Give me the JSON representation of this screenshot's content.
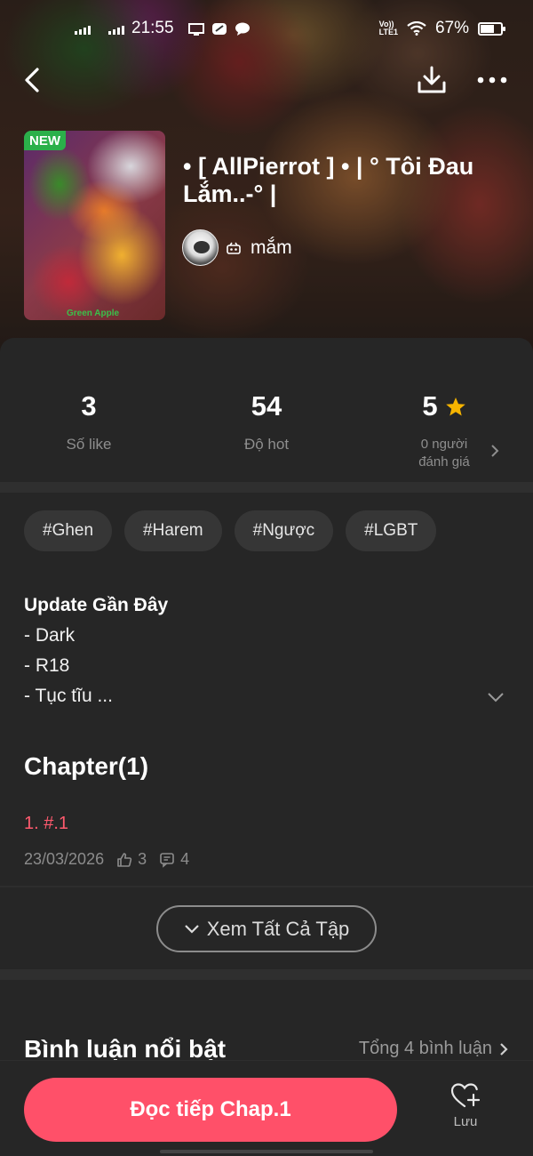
{
  "status_bar": {
    "time": "21:55",
    "network_label": "Vo))\nLTE1",
    "battery_percent": "67%",
    "battery_level": 0.67
  },
  "story": {
    "badge": "NEW",
    "cover_signature": "Green Apple",
    "title": "• [ AllPierrot ] • | ° Tôi Đau Lắm..-° |",
    "author": "mắm"
  },
  "stats": {
    "likes_value": "3",
    "likes_label": "Số like",
    "hot_value": "54",
    "hot_label": "Độ hot",
    "rating_value": "5",
    "rating_sub_line1": "0 người",
    "rating_sub_line2": "đánh giá"
  },
  "tags": [
    "#Ghen",
    "#Harem",
    "#Ngược",
    "#LGBT"
  ],
  "description": {
    "title": "Update Gần Đây",
    "lines": [
      "- Dark",
      "- R18",
      "- Tục tĩu ..."
    ]
  },
  "chapters": {
    "heading": "Chapter(1)",
    "items": [
      {
        "title": "1. #.1",
        "date": "23/03/2026",
        "likes": "3",
        "comments": "4"
      }
    ],
    "view_all_label": "Xem Tất Cả Tập"
  },
  "comments": {
    "heading": "Bình luận nổi bật",
    "total_label": "Tổng 4 bình luận"
  },
  "bottom_bar": {
    "read_label": "Đọc tiếp Chap.1",
    "save_label": "Lưu"
  },
  "colors": {
    "accent": "#ff5069",
    "chapter_link": "#ff5a6e",
    "star": "#f6b400",
    "new_badge": "#2bb04a",
    "background": "#262626"
  },
  "icons": [
    "back-arrow-icon",
    "download-icon",
    "more-icon",
    "star-icon",
    "chevron-right-icon",
    "chevron-down-icon",
    "thumbs-up-icon",
    "comment-icon",
    "heart-plus-icon",
    "wifi-icon",
    "battery-icon"
  ]
}
